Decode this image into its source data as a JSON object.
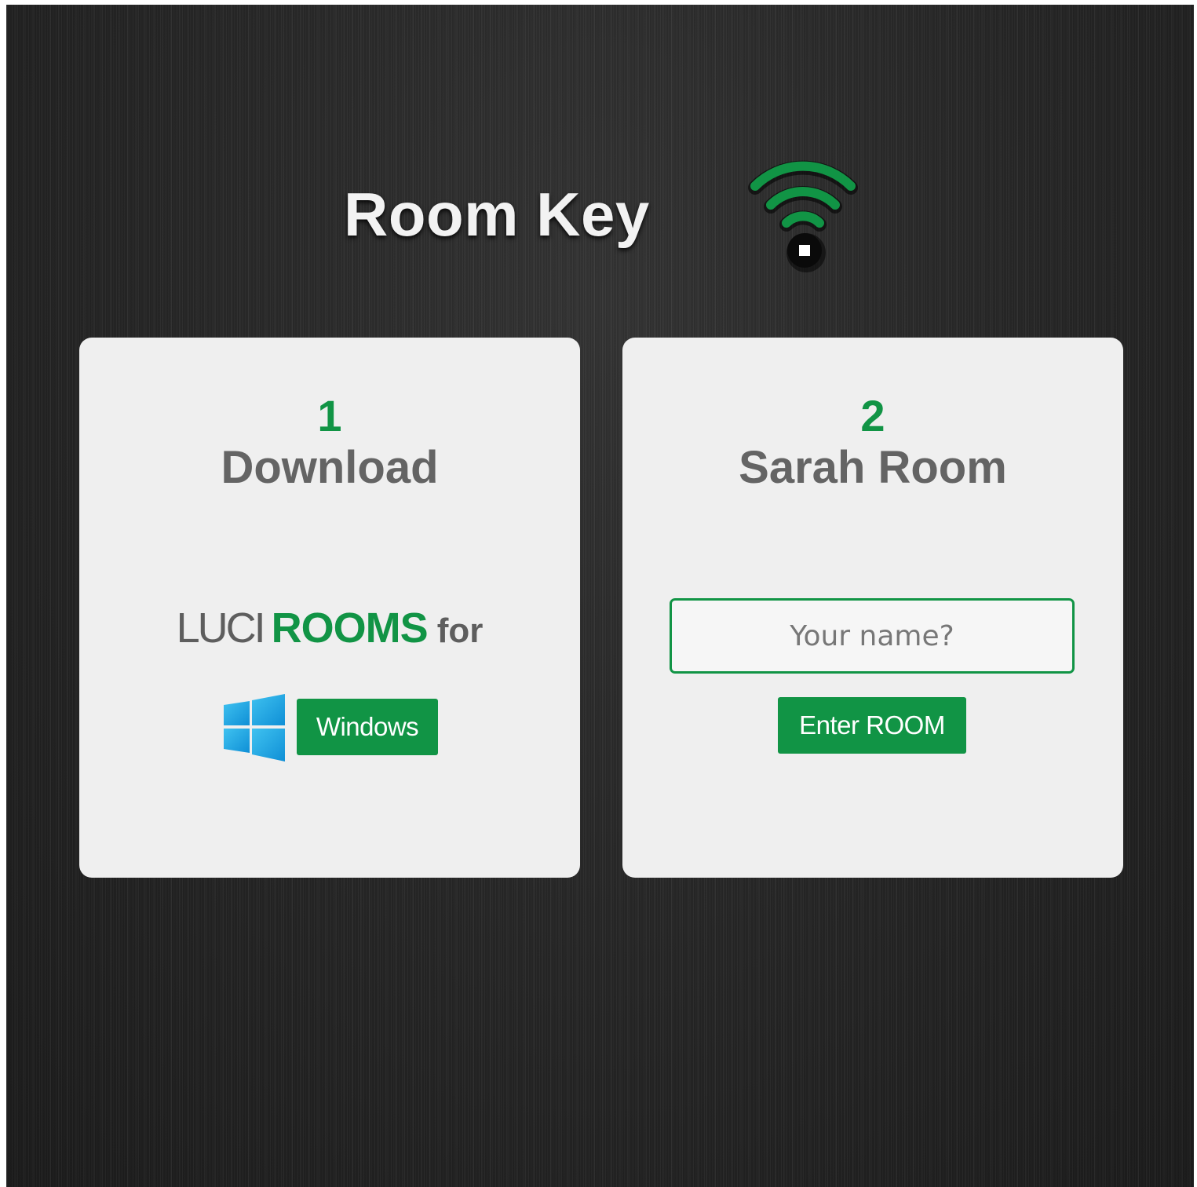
{
  "header": {
    "title": "Room Key",
    "logo_icon": "wifi-key-icon",
    "logo_color": "#119445"
  },
  "download_card": {
    "step_number": "1",
    "step_title": "Download",
    "brand_luci": "LUCI",
    "brand_rooms": "ROOMS",
    "brand_for": "for",
    "platform_icon": "windows-logo-icon",
    "windows_button_label": "Windows"
  },
  "room_card": {
    "step_number": "2",
    "step_title": "Sarah Room",
    "name_input_value": "",
    "name_input_placeholder": "Your name?",
    "enter_button_label": "Enter ROOM"
  },
  "colors": {
    "accent": "#119445",
    "card_background": "#efefef",
    "page_background": "#262626",
    "title_text": "#f2f2f2",
    "heading_text": "#646464"
  }
}
